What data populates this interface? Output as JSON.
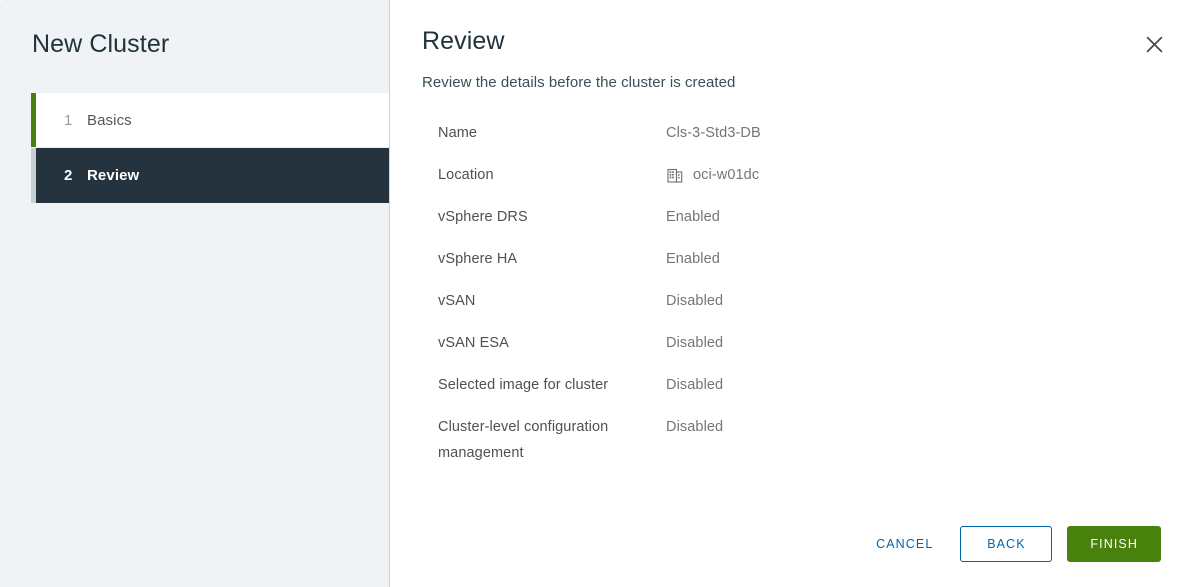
{
  "sidebar": {
    "title": "New Cluster",
    "steps": [
      {
        "number": "1",
        "label": "Basics",
        "state": "done"
      },
      {
        "number": "2",
        "label": "Review",
        "state": "current"
      }
    ]
  },
  "content": {
    "title": "Review",
    "subtitle": "Review the details before the cluster is created",
    "close_icon": "close-icon",
    "details": [
      {
        "label": "Name",
        "value": "Cls-3-Std3-DB",
        "icon": null
      },
      {
        "label": "Location",
        "value": "oci-w01dc",
        "icon": "datacenter-icon"
      },
      {
        "label": "vSphere DRS",
        "value": "Enabled",
        "icon": null
      },
      {
        "label": "vSphere HA",
        "value": "Enabled",
        "icon": null
      },
      {
        "label": "vSAN",
        "value": "Disabled",
        "icon": null
      },
      {
        "label": "vSAN ESA",
        "value": "Disabled",
        "icon": null
      },
      {
        "label": "Selected image for cluster",
        "value": "Disabled",
        "icon": null
      },
      {
        "label": "Cluster-level configuration management",
        "value": "Disabled",
        "icon": null
      }
    ]
  },
  "footer": {
    "cancel_label": "CANCEL",
    "back_label": "BACK",
    "finish_label": "FINISH"
  },
  "colors": {
    "accent_green": "#48810c",
    "link_blue": "#0065ab",
    "step_active_bg": "#25333f",
    "sidebar_bg": "#eff3f6",
    "rail_inactive": "#c8d0d3"
  }
}
